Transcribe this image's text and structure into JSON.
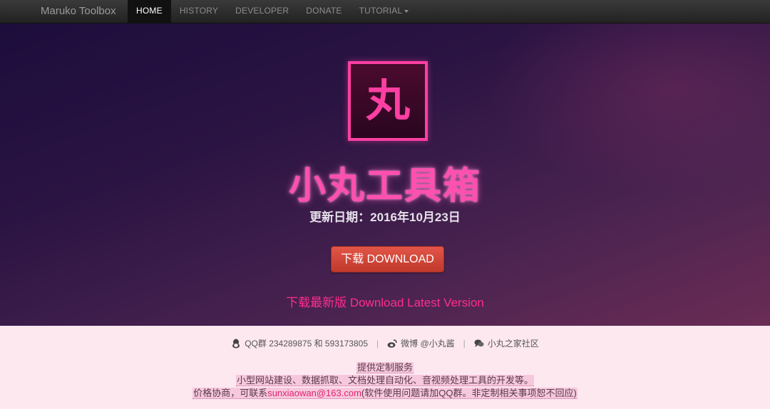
{
  "nav": {
    "brand": "Maruko Toolbox",
    "items": [
      {
        "label": "HOME",
        "active": true
      },
      {
        "label": "HISTORY",
        "active": false
      },
      {
        "label": "DEVELOPER",
        "active": false
      },
      {
        "label": "DONATE",
        "active": false
      },
      {
        "label": "TUTORIAL",
        "active": false,
        "dropdown": true
      }
    ]
  },
  "hero": {
    "logo_glyph": "丸",
    "title": "小丸工具箱",
    "update_date": "更新日期：2016年10月23日",
    "download_button": "下载 DOWNLOAD",
    "latest_link": "下载最新版 Download Latest Version"
  },
  "footer": {
    "qq": "QQ群 234289875 和 593173805",
    "weibo": "微博 @小丸酱",
    "community": "小丸之家社区",
    "notes": {
      "line1": "提供定制服务",
      "line2": "小型网站建设、数据抓取、文档处理自动化、音视频处理工具的开发等。",
      "line3_prefix": "价格协商，可联系",
      "line3_email": "sunxiaowan@163.com",
      "line3_suffix": "(软件使用问题请加QQ群。非定制相关事项恕不回应)"
    }
  },
  "colors": {
    "accent_pink": "#ff3fa2",
    "button_red": "#d9473a",
    "footer_bg": "#fde8f0"
  }
}
